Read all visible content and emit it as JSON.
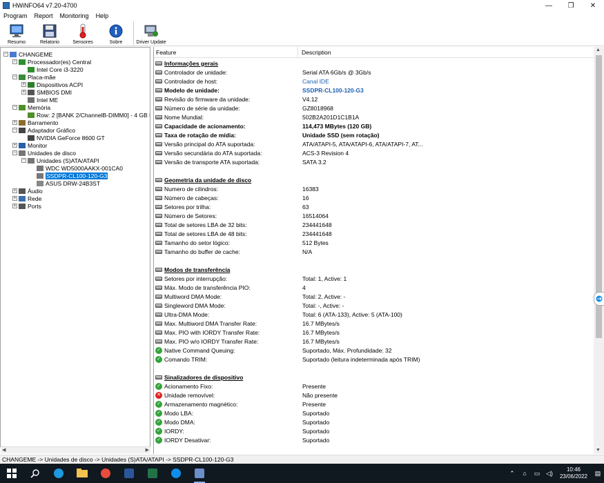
{
  "window": {
    "title": "HWiNFO64 v7.20-4700",
    "minimize": "—",
    "restore": "❐",
    "close": "✕"
  },
  "menu": [
    "Program",
    "Report",
    "Monitoring",
    "Help"
  ],
  "toolbar": [
    {
      "label": "Resumo",
      "icon": "monitor-icon"
    },
    {
      "label": "Relatorio",
      "icon": "floppy-icon"
    },
    {
      "label": "Sensores",
      "icon": "thermometer-icon"
    },
    {
      "label": "Sobre",
      "icon": "info-icon"
    },
    {
      "label": "Driver Update",
      "icon": "driver-update-icon"
    }
  ],
  "tree": [
    {
      "label": "CHANGEME",
      "indent": 0,
      "expander": "−",
      "icon": "computer"
    },
    {
      "label": "Processador(es) Central",
      "indent": 1,
      "expander": "−",
      "icon": "cpu"
    },
    {
      "label": "Intel Core i3-3220",
      "indent": 2,
      "expander": "",
      "icon": "cpu-chip"
    },
    {
      "label": "Placa-mãe",
      "indent": 1,
      "expander": "−",
      "icon": "board"
    },
    {
      "label": "Dispositivos ACPI",
      "indent": 2,
      "expander": "+",
      "icon": "acpi"
    },
    {
      "label": "SMBIOS DMI",
      "indent": 2,
      "expander": "+",
      "icon": "chip"
    },
    {
      "label": "Intel ME",
      "indent": 2,
      "expander": "",
      "icon": "gear"
    },
    {
      "label": "Memória",
      "indent": 1,
      "expander": "−",
      "icon": "memory"
    },
    {
      "label": "Row: 2 [BANK 2/ChannelB-DIMM0] - 4 GB I",
      "indent": 2,
      "expander": "",
      "icon": "memory"
    },
    {
      "label": "Barramento",
      "indent": 1,
      "expander": "+",
      "icon": "bus"
    },
    {
      "label": "Adaptador Gráfico",
      "indent": 1,
      "expander": "−",
      "icon": "gpu"
    },
    {
      "label": "NVIDIA GeForce 8600 GT",
      "indent": 2,
      "expander": "",
      "icon": "gpu"
    },
    {
      "label": "Monitor",
      "indent": 1,
      "expander": "+",
      "icon": "monitor"
    },
    {
      "label": "Unidades de disco",
      "indent": 1,
      "expander": "−",
      "icon": "disk"
    },
    {
      "label": "Unidades (S)ATA/ATAPI",
      "indent": 2,
      "expander": "−",
      "icon": "disk"
    },
    {
      "label": "WDC WD5000AAKX-001CA0",
      "indent": 3,
      "expander": "",
      "icon": "disk"
    },
    {
      "label": "SSDPR-CL100-120-G3",
      "indent": 3,
      "expander": "",
      "icon": "disk",
      "selected": true
    },
    {
      "label": "ASUS DRW-24B3ST",
      "indent": 3,
      "expander": "",
      "icon": "optical"
    },
    {
      "label": "Áudio",
      "indent": 1,
      "expander": "+",
      "icon": "audio"
    },
    {
      "label": "Rede",
      "indent": 1,
      "expander": "+",
      "icon": "network"
    },
    {
      "label": "Ports",
      "indent": 1,
      "expander": "+",
      "icon": "ports"
    }
  ],
  "detail": {
    "columns": {
      "feature": "Feature",
      "description": "Description"
    },
    "rows": [
      {
        "type": "section",
        "feature": "Informações gerais",
        "row": 1
      },
      {
        "icon": "drive",
        "feature": "Controlador de unidade:",
        "desc": "Serial ATA 6Gb/s @ 3Gb/s",
        "row": 2
      },
      {
        "icon": "drive",
        "feature": "Controlador de host:",
        "desc": "Canal IDE",
        "style": "link",
        "row": 3
      },
      {
        "icon": "drive",
        "feature": "Modelo de unidade:",
        "desc": "SSDPR-CL100-120-G3",
        "style": "bold-link",
        "bold": true,
        "row": 4
      },
      {
        "icon": "drive",
        "feature": "Revisão do firmware da unidade:",
        "desc": "V4.12",
        "row": 5
      },
      {
        "icon": "drive",
        "feature": "Número de série da unidade:",
        "desc": "GZ8018968",
        "row": 6
      },
      {
        "icon": "drive",
        "feature": "Nome Mundial:",
        "desc": "502B2A201D1C1B1A",
        "row": 7
      },
      {
        "icon": "drive",
        "feature": "Capacidade de acionamento:",
        "desc": "114,473 MBytes (120 GB)",
        "bold": true,
        "style": "bold",
        "row": 8
      },
      {
        "icon": "drive",
        "feature": "Taxa de rotação de mídia:",
        "desc": "Unidade SSD (sem rotação)",
        "bold": true,
        "style": "bold",
        "row": 9
      },
      {
        "icon": "drive",
        "feature": "Versão principal do ATA suportada:",
        "desc": "ATA/ATAPI-5, ATA/ATAPI-6, ATA/ATAPI-7, AT...",
        "row": 10
      },
      {
        "icon": "drive",
        "feature": "Versão secundária do ATA suportada:",
        "desc": "ACS-3 Revision 4",
        "row": 11
      },
      {
        "icon": "drive",
        "feature": "Versão de transporte ATA suportada:",
        "desc": "SATA 3.2",
        "row": 12
      },
      {
        "type": "section",
        "feature": "Geometria da unidade de disco",
        "row": 14
      },
      {
        "icon": "drive",
        "feature": "Numero de cilindros:",
        "desc": "16383",
        "row": 15
      },
      {
        "icon": "drive",
        "feature": "Número de cabeças:",
        "desc": "16",
        "row": 16
      },
      {
        "icon": "drive",
        "feature": "Setores por trilha:",
        "desc": "63",
        "row": 17
      },
      {
        "icon": "drive",
        "feature": "Número de Setores:",
        "desc": "16514064",
        "row": 18
      },
      {
        "icon": "drive",
        "feature": "Total de setores LBA de 32 bits:",
        "desc": "234441648",
        "row": 19
      },
      {
        "icon": "drive",
        "feature": "Total de setores LBA de 48 bits:",
        "desc": "234441648",
        "row": 20
      },
      {
        "icon": "drive",
        "feature": "Tamanho do setor lógico:",
        "desc": "512 Bytes",
        "row": 21
      },
      {
        "icon": "drive",
        "feature": "Tamanho do buffer de cache:",
        "desc": "N/A",
        "row": 22
      },
      {
        "type": "section",
        "feature": "Modos de transferência",
        "row": 24
      },
      {
        "icon": "drive",
        "feature": "Setores por interrupção:",
        "desc": "Total: 1, Active: 1",
        "row": 25
      },
      {
        "icon": "drive",
        "feature": "Máx. Modo de transferência PIO:",
        "desc": "4",
        "row": 26
      },
      {
        "icon": "drive",
        "feature": "Multiword DMA Mode:",
        "desc": "Total: 2, Active: -",
        "row": 27
      },
      {
        "icon": "drive",
        "feature": "Singleword DMA Mode:",
        "desc": "Total: -, Active: -",
        "row": 28
      },
      {
        "icon": "drive",
        "feature": "Ultra-DMA Mode:",
        "desc": "Total: 6 (ATA-133), Active: 5 (ATA-100)",
        "row": 29
      },
      {
        "icon": "drive",
        "feature": "Max. Multiword DMA Transfer Rate:",
        "desc": "16.7 MBytes/s",
        "row": 30
      },
      {
        "icon": "drive",
        "feature": "Max. PIO with IORDY Transfer Rate:",
        "desc": "16.7 MBytes/s",
        "row": 31
      },
      {
        "icon": "drive",
        "feature": "Max. PIO w/o IORDY Transfer Rate:",
        "desc": "16.7 MBytes/s",
        "row": 32
      },
      {
        "icon": "ok",
        "feature": "Native Command Queuing:",
        "desc": "Suportado, Máx. Profundidade: 32",
        "row": 33
      },
      {
        "icon": "ok",
        "feature": "Comando TRIM:",
        "desc": "Suportado (leitura indeterminada após TRIM)",
        "row": 34
      },
      {
        "type": "section",
        "feature": "Sinalizadores de dispositivo",
        "row": 36
      },
      {
        "icon": "ok",
        "feature": "Acionamento Fixo:",
        "desc": "Presente",
        "row": 37
      },
      {
        "icon": "no",
        "feature": "Unidade removível:",
        "desc": "Não presente",
        "row": 38
      },
      {
        "icon": "ok",
        "feature": "Armazenamento magnético:",
        "desc": "Presente",
        "row": 39
      },
      {
        "icon": "ok",
        "feature": "Modo LBA:",
        "desc": "Suportado",
        "row": 40
      },
      {
        "icon": "ok",
        "feature": "Modo DMA:",
        "desc": "Suportado",
        "row": 41
      },
      {
        "icon": "ok",
        "feature": "IORDY:",
        "desc": "Suportado",
        "row": 42
      },
      {
        "icon": "ok",
        "feature": "IORDY Desativar:",
        "desc": "Suportado",
        "row": 43
      }
    ]
  },
  "status": "CHANGEME -> Unidades de disco -> Unidades (S)ATA/ATAPI -> SSDPR-CL100-120-G3",
  "taskbar": {
    "apps": [
      "start-icon",
      "search-icon",
      "edge-icon",
      "file-explorer-icon",
      "chrome-icon",
      "word-icon",
      "excel-icon",
      "teamviewer-icon",
      "hwinfo-icon"
    ],
    "clock_time": "10:46",
    "clock_date": "23/06/2022"
  }
}
